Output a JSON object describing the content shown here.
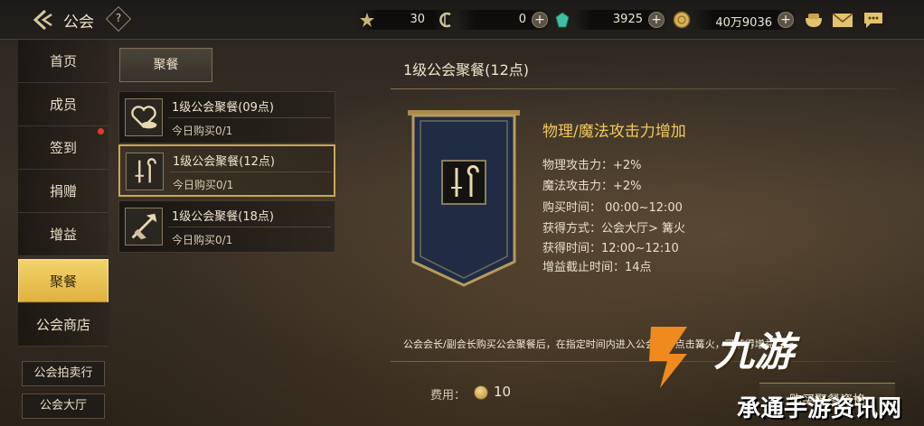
{
  "header": {
    "title": "公会",
    "help_label": "?",
    "resources": [
      {
        "icon": "star-badge-icon",
        "value": "30"
      },
      {
        "icon": "crescent-currency-icon",
        "value": "0"
      },
      {
        "icon": "green-gem-icon",
        "value": "3925"
      },
      {
        "icon": "gold-coin-icon",
        "value": "40万9036"
      }
    ],
    "right_icons": [
      "bag-icon",
      "mail-icon",
      "chat-icon"
    ]
  },
  "nav": {
    "items": [
      "首页",
      "成员",
      "签到",
      "捐赠",
      "增益",
      "聚餐",
      "公会商店"
    ],
    "active_index": 5,
    "sub_items": [
      "公会拍卖行",
      "公会大厅"
    ]
  },
  "meals": {
    "tab_label": "聚餐",
    "list": [
      {
        "name": "1级公会聚餐(09点)",
        "sub": "今日购买0/1",
        "icon": "heart-food-icon"
      },
      {
        "name": "1级公会聚餐(12点)",
        "sub": "今日购买0/1",
        "icon": "sword-staff-icon",
        "selected": true
      },
      {
        "name": "1级公会聚餐(18点)",
        "sub": "今日购买0/1",
        "icon": "axe-weapon-icon"
      }
    ]
  },
  "detail": {
    "title": "1级公会聚餐(12点)",
    "buff_title": "物理/魔法攻击力增加",
    "lines": [
      "物理攻击力：+2%",
      "魔法攻击力：+2%",
      "购买时间：  00:00~12:00",
      "获得方式：公会大厅> 篝火",
      "获得时间：12:00~12:10",
      "增益截止时间：14点"
    ],
    "description": "公会会长/副会长购买公会聚餐后，在指定时间内进入公会大厅点击篝火，可获得增益效果",
    "cost_label": "费用：",
    "cost_value": "10",
    "buy_label": "购买聚餐资格"
  },
  "watermark": {
    "brand": "九游",
    "url": "承通手游资讯网"
  },
  "colors": {
    "accent_gold": "#f0c862",
    "active_tab": "#e1b23e",
    "badge_red": "#e23a2a"
  }
}
